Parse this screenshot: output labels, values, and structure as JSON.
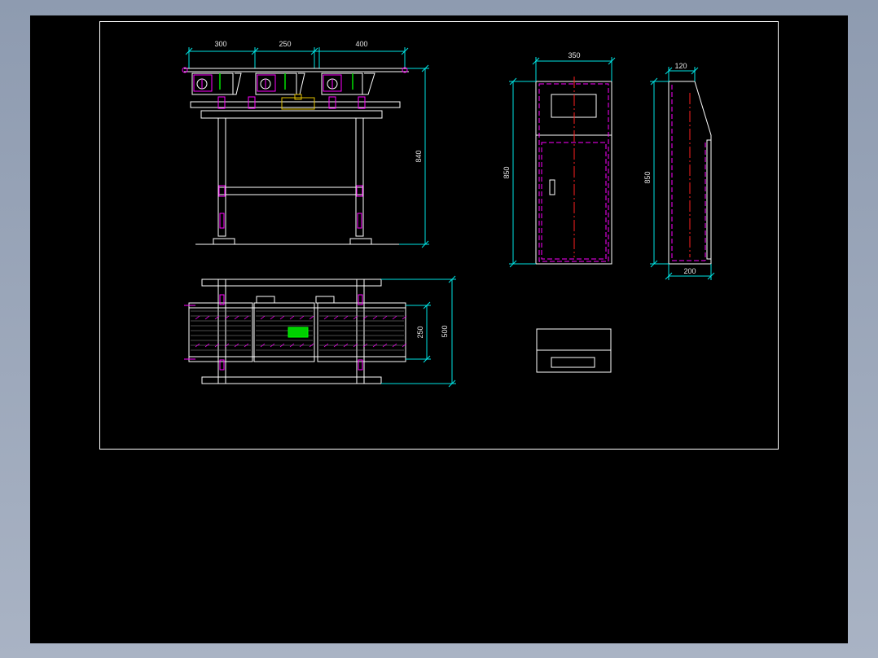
{
  "colors": {
    "background": "#000000",
    "frame": "#ffffff",
    "dimension": "#00e5e5",
    "outline": "#ffffff",
    "hidden": "#ff00ff",
    "center": "#ff2020",
    "accent_green": "#00e000",
    "accent_yellow": "#e0c000"
  },
  "front_view": {
    "dim_top_1": "300",
    "dim_top_2": "250",
    "dim_top_3": "400",
    "dim_height": "840"
  },
  "top_view": {
    "dim_inner_width": "250",
    "dim_outer_width": "500"
  },
  "cabinet_front": {
    "dim_width": "350",
    "dim_height": "850"
  },
  "cabinet_side": {
    "dim_top": "120",
    "dim_height": "850",
    "dim_bottom": "200"
  }
}
